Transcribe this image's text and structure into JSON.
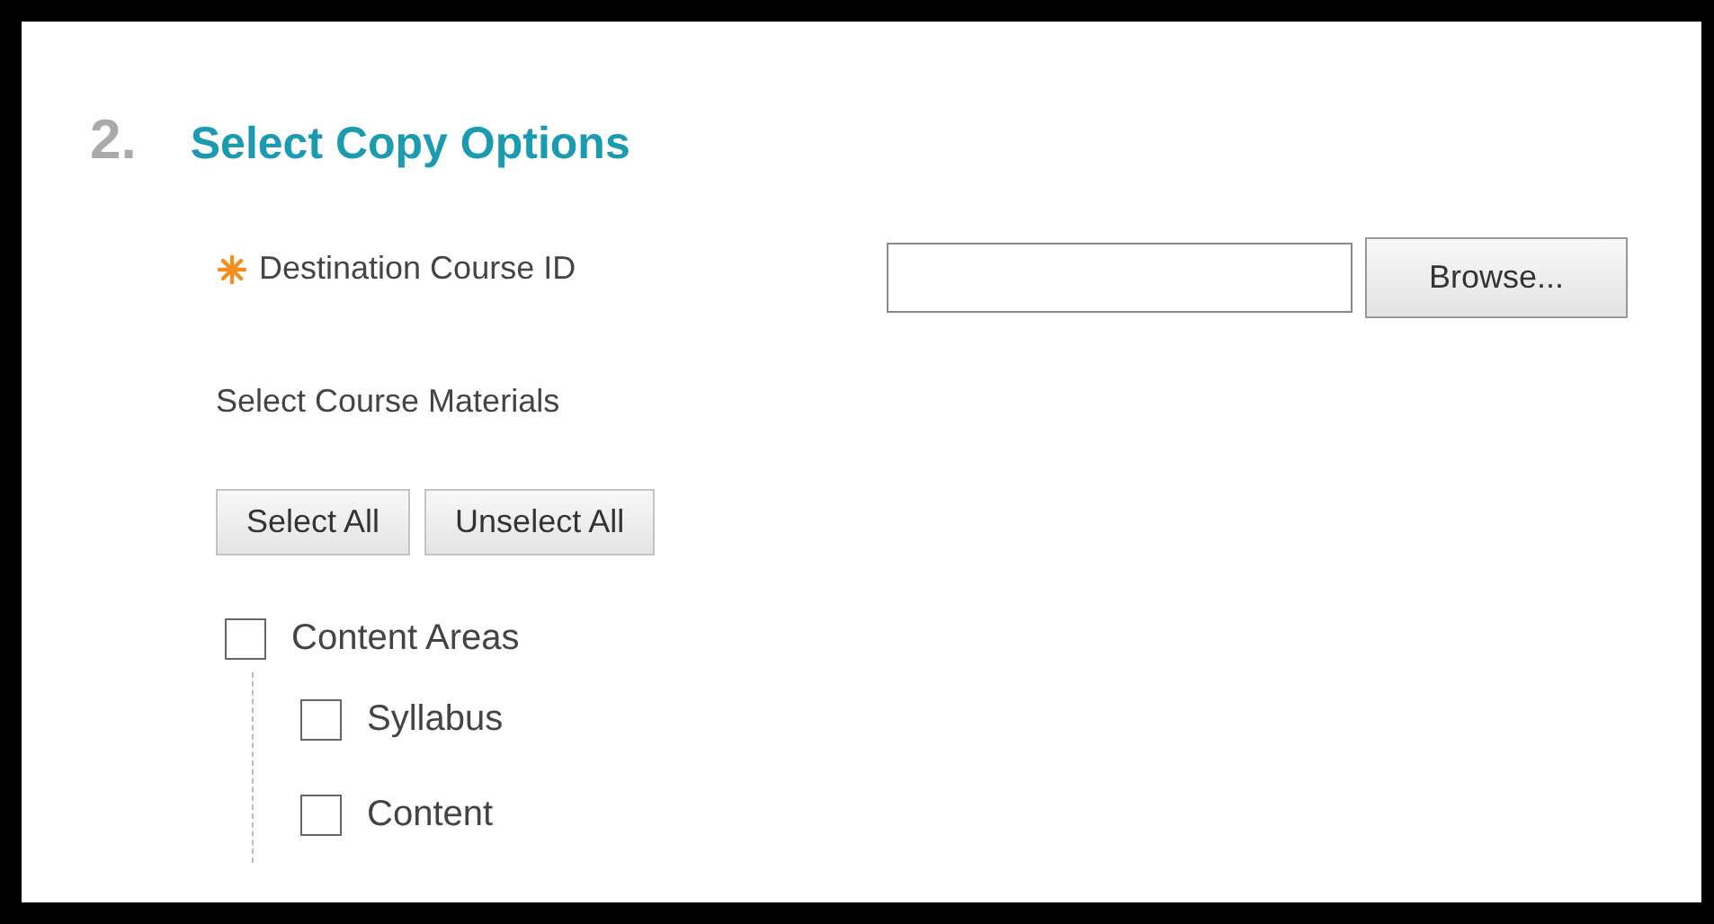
{
  "section": {
    "number": "2.",
    "title": "Select Copy Options"
  },
  "destination": {
    "label": "Destination Course ID",
    "required": true,
    "button": "Browse..."
  },
  "materials": {
    "label": "Select Course Materials",
    "buttons": [
      "Select All",
      "Unselect All"
    ]
  },
  "tree": [
    {
      "label": "Content Areas",
      "checked": false,
      "children": [
        {
          "label": "Syllabus",
          "checked": false
        },
        {
          "label": "Content",
          "checked": false
        }
      ]
    }
  ]
}
